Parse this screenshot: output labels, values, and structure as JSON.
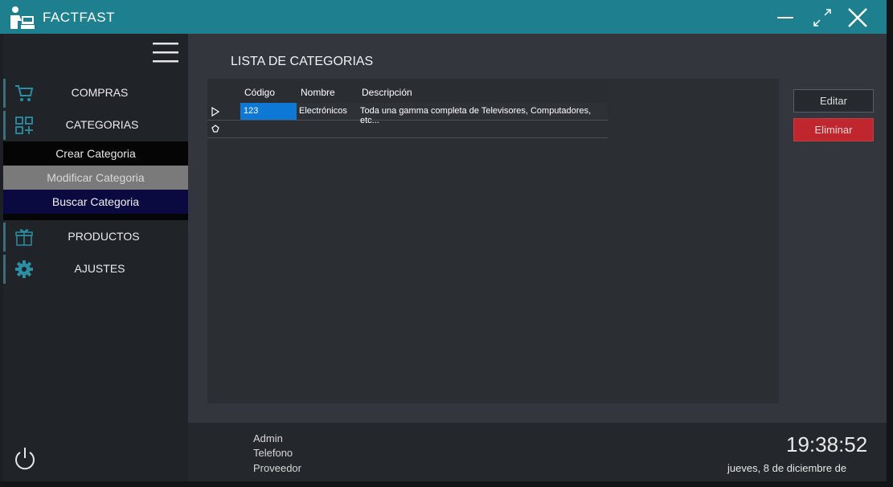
{
  "app": {
    "title": "FACTFAST"
  },
  "window_controls": {
    "minimize_icon": "minimize-icon",
    "maximize_icon": "maximize-icon",
    "close_icon": "close-icon"
  },
  "sidebar": {
    "items": [
      {
        "label": "COMPRAS",
        "icon": "cart-icon"
      },
      {
        "label": "CATEGORIAS",
        "icon": "categories-grid-icon"
      },
      {
        "label": "PRODUCTOS",
        "icon": "gift-box-icon"
      },
      {
        "label": "AJUSTES",
        "icon": "gear-icon"
      }
    ],
    "subitems": [
      {
        "label": "Crear Categoria"
      },
      {
        "label": "Modificar Categoria"
      },
      {
        "label": "Buscar Categoria"
      }
    ]
  },
  "main": {
    "title": "LISTA DE CATEGORIAS",
    "grid": {
      "columns": [
        "Código",
        "Nombre",
        "Descripción"
      ],
      "rows": [
        [
          "123",
          "Electrónicos",
          "Toda una gamma completa de Televisores, Computadores, etc..."
        ]
      ]
    },
    "buttons": {
      "edit_label": "Editar",
      "delete_label": "Eliminar"
    }
  },
  "footer": {
    "user_lines": [
      "Admin",
      "Telefono",
      "Proveedor"
    ],
    "time": "19:38:52",
    "date": "jueves, 8 de diciembre de"
  },
  "colors": {
    "titlebar": "#1e7f8f",
    "sidebar": "#202328",
    "main": "#33373d",
    "selected_cell": "#0d78d6",
    "delete_button": "#c0262d",
    "accent_icon": "#2a8fa3"
  }
}
